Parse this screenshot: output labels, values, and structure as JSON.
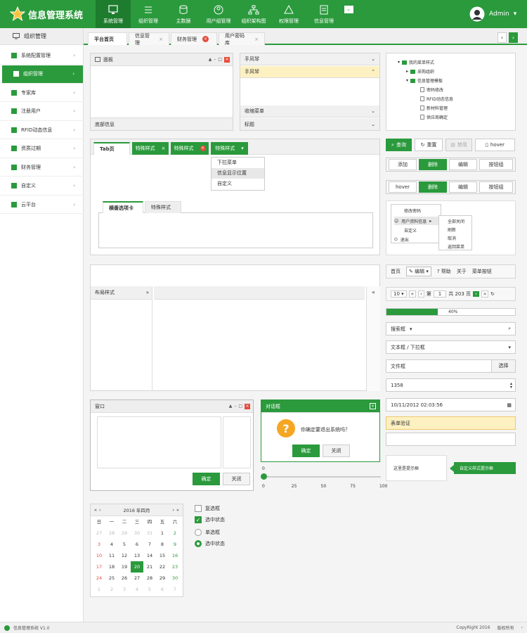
{
  "app": {
    "title": "信息管理系统",
    "user": "Admin"
  },
  "nav": [
    {
      "label": "系统管理",
      "icon": "monitor-icon"
    },
    {
      "label": "组织管理",
      "icon": "list-icon"
    },
    {
      "label": "主数据",
      "icon": "database-icon"
    },
    {
      "label": "用户组管理",
      "icon": "users-icon"
    },
    {
      "label": "组织架构图",
      "icon": "org-chart-icon"
    },
    {
      "label": "权限管理",
      "icon": "triangle-icon"
    },
    {
      "label": "信息管理",
      "icon": "document-icon"
    }
  ],
  "sidebar": {
    "header": "组织管理",
    "items": [
      "系统配置管理",
      "组织管理",
      "专家库",
      "注册用户",
      "RFID动态信息",
      "资质过期",
      "财务管理",
      "自定义",
      "云平台"
    ]
  },
  "tabs": [
    {
      "label": "平台首页"
    },
    {
      "label": "信息管理"
    },
    {
      "label": "财务管理"
    },
    {
      "label": "用户密码库"
    }
  ],
  "panel": {
    "title": "面板",
    "footer": "底部信息"
  },
  "accordion": {
    "header": "手风琴",
    "selected": "手风琴",
    "collapse1": "收缩菜单",
    "collapse2": "标题"
  },
  "tree": {
    "root": "我的菜单样式",
    "n1": "采购组织",
    "n2": "信息管理模板",
    "leaves": [
      "密码修改",
      "RFID动态信息",
      "新材料管理",
      "供应商确定"
    ]
  },
  "tabdemo": {
    "tabs": [
      "Tab页",
      "特殊样式",
      "特殊样式",
      "特殊样式"
    ],
    "menu": [
      "下拉菜单",
      "信息显示位置",
      "自定义"
    ],
    "inner_tabs": [
      "横番选项卡",
      "特殊样式"
    ]
  },
  "buttons": {
    "row1": [
      "查询",
      "重置",
      "禁用",
      "hover"
    ],
    "row2": [
      "添加",
      "删除",
      "编辑",
      "按钮组"
    ],
    "row3": [
      "hover",
      "删除",
      "编辑",
      "按钮组"
    ]
  },
  "ctxmenu": {
    "items": [
      "修改密码",
      "用户资料信息",
      "自定义",
      "退出"
    ],
    "sub": [
      "全部关闭",
      "刷新",
      "取消",
      "返回菜单"
    ]
  },
  "layout": {
    "west_title": "布局样式",
    "collapse": "»",
    "expand": "«"
  },
  "toolbar": {
    "items": [
      "首页",
      "编辑",
      "帮助",
      "关于",
      "菜单按钮"
    ]
  },
  "pager": {
    "size": "10",
    "page_label_pre": "第",
    "page": "1",
    "page_label_post": "共 203 页"
  },
  "progress": {
    "value": 0.4,
    "label": "40%"
  },
  "form": {
    "search": "搜索框",
    "combo": "文本框 / 下拉框",
    "file": "文件框",
    "file_btn": "选择",
    "number": "1358",
    "datetime": "10/11/2012 02:03:56",
    "validate": "表单验证",
    "tooltip": "这里是提示框",
    "tooltip2": "自定义样式提示框"
  },
  "window": {
    "title": "窗口",
    "ok": "确定",
    "close": "关闭"
  },
  "dialog": {
    "title": "对话框",
    "msg": "你确定要退出系统吗？",
    "ok": "确定",
    "close": "关闭"
  },
  "slider": {
    "value": 0,
    "ticks": [
      "0",
      "25",
      "50",
      "75",
      "100"
    ],
    "top": "0"
  },
  "calendar": {
    "title": "2016 年四月",
    "weekdays": [
      "日",
      "一",
      "二",
      "三",
      "四",
      "五",
      "六"
    ],
    "rows": [
      [
        "27",
        "28",
        "29",
        "30",
        "31",
        "1",
        "2"
      ],
      [
        "3",
        "4",
        "5",
        "6",
        "7",
        "8",
        "9"
      ],
      [
        "10",
        "11",
        "12",
        "13",
        "14",
        "15",
        "16"
      ],
      [
        "17",
        "18",
        "19",
        "20",
        "21",
        "22",
        "23"
      ],
      [
        "24",
        "25",
        "26",
        "27",
        "28",
        "29",
        "30"
      ],
      [
        "1",
        "2",
        "3",
        "4",
        "5",
        "6",
        "7"
      ]
    ],
    "selected": "20"
  },
  "checks": {
    "c1": "复选框",
    "c2": "选中状态",
    "r1": "单选框",
    "r2": "选中状态"
  },
  "footer": {
    "left": "信息管理系统 V1.0",
    "copy": "CopyRight 2016",
    "rights": "版权所有"
  },
  "colors": {
    "primary": "#2a9a3c",
    "danger": "#e64b3b",
    "warn": "#f5a623"
  }
}
